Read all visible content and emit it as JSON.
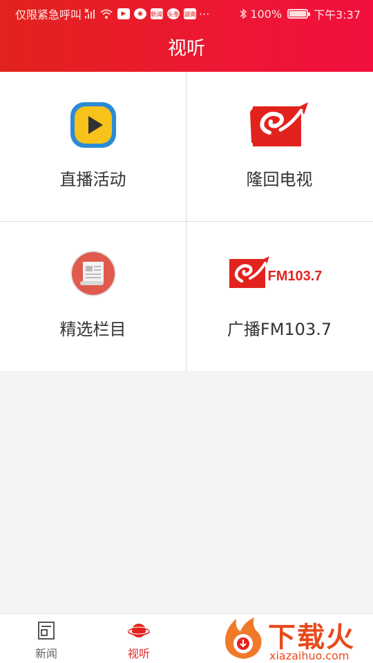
{
  "status_bar": {
    "carrier": "仅限紧急呼叫",
    "battery": "100%",
    "time": "下午3:37",
    "app_icons": [
      "video-app-icon",
      "browser-app-icon",
      "news-app-icon",
      "toutiao-app-icon",
      "local-app-icon"
    ],
    "app_texts": [
      "",
      "",
      "新闻",
      "头条",
      "湖南"
    ]
  },
  "header": {
    "title": "视听"
  },
  "grid": {
    "items": [
      {
        "label": "直播活动",
        "icon": "live-play-icon"
      },
      {
        "label": "隆回电视",
        "icon": "longhui-tv-logo-icon"
      },
      {
        "label": "精选栏目",
        "icon": "scroll-document-icon"
      },
      {
        "label": "广播FM103.7",
        "icon": "fm-radio-logo-icon",
        "logo_text": "FM103.7"
      }
    ]
  },
  "bottom_nav": {
    "items": [
      {
        "label": "新闻",
        "icon": "news-icon",
        "active": false
      },
      {
        "label": "视听",
        "icon": "planet-icon",
        "active": true
      }
    ]
  },
  "watermark": {
    "text": "下载火",
    "sub": "xiazaihuo.com"
  },
  "colors": {
    "accent": "#e2231d",
    "header_gradient_end": "#f20f3e"
  }
}
